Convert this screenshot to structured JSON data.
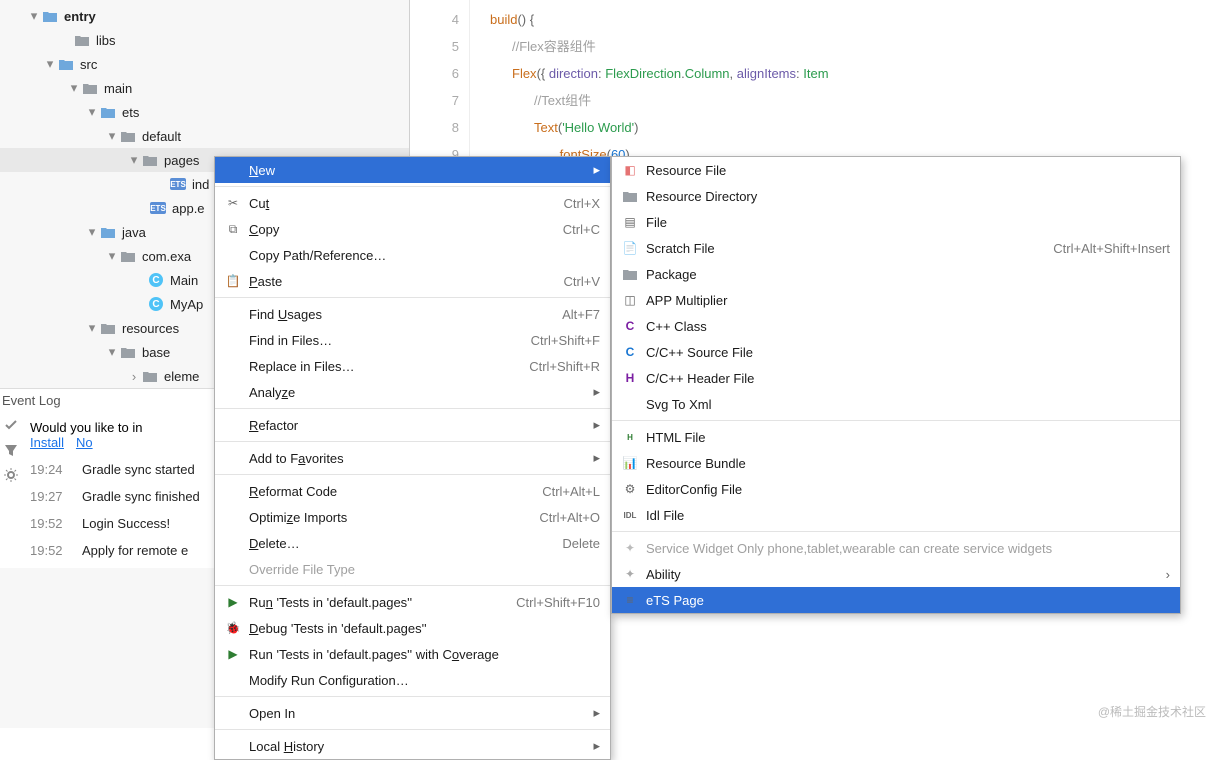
{
  "tree": {
    "entry": "entry",
    "libs": "libs",
    "src": "src",
    "main": "main",
    "ets": "ets",
    "default": "default",
    "pages": "pages",
    "index_file": "ind",
    "app_file": "app.e",
    "java": "java",
    "com_exa": "com.exa",
    "main_file": "Main",
    "myapp": "MyAp",
    "resources": "resources",
    "base": "base",
    "elem": "eleme"
  },
  "editor": {
    "lines": [
      "4",
      "5",
      "6",
      "7",
      "8",
      "9"
    ],
    "l4_fn": "build",
    "l4_rest": "() {",
    "l5_cm": "//Flex容器组件",
    "l6_fn": "Flex",
    "l6_p1": "direction",
    "l6_v1": "FlexDirection",
    "l6_v1b": "Column",
    "l6_p2": "alignItems",
    "l6_v2": "Item",
    "l7_cm": "//Text组件",
    "l8_fn": "Text",
    "l8_str": "'Hello World'",
    "l9_fn": "fontSize",
    "l9_num": "60"
  },
  "eventlog": {
    "title": "Event Log",
    "prompt": "Would you like to in",
    "install": "Install",
    "no": "No",
    "rows": [
      {
        "t": "19:24",
        "m": "Gradle sync started"
      },
      {
        "t": "19:27",
        "m": "Gradle sync finished"
      },
      {
        "t": "19:52",
        "m": "Login Success!"
      },
      {
        "t": "19:52",
        "m": "Apply for remote e"
      }
    ]
  },
  "menu": {
    "new": "New",
    "cut": "Cut",
    "cut_s": "Ctrl+X",
    "copy": "Copy",
    "copy_s": "Ctrl+C",
    "copypath": "Copy Path/Reference…",
    "paste": "Paste",
    "paste_s": "Ctrl+V",
    "findusages": "Find Usages",
    "findusages_s": "Alt+F7",
    "findfiles": "Find in Files…",
    "findfiles_s": "Ctrl+Shift+F",
    "replace": "Replace in Files…",
    "replace_s": "Ctrl+Shift+R",
    "analyze": "Analyze",
    "refactor": "Refactor",
    "favorites": "Add to Favorites",
    "reformat": "Reformat Code",
    "reformat_s": "Ctrl+Alt+L",
    "optimize": "Optimize Imports",
    "optimize_s": "Ctrl+Alt+O",
    "delete": "Delete…",
    "delete_s": "Delete",
    "override": "Override File Type",
    "runtests": "Run 'Tests in 'default.pages''",
    "runtests_s": "Ctrl+Shift+F10",
    "debugtests": "Debug 'Tests in 'default.pages''",
    "runcov": "Run 'Tests in 'default.pages'' with Coverage",
    "modifyrun": "Modify Run Configuration…",
    "openin": "Open In",
    "localhist": "Local History"
  },
  "submenu": {
    "resfile": "Resource File",
    "resdir": "Resource Directory",
    "file": "File",
    "scratch": "Scratch File",
    "scratch_s": "Ctrl+Alt+Shift+Insert",
    "package": "Package",
    "appmult": "APP Multiplier",
    "cppclass": "C++ Class",
    "ccsrc": "C/C++ Source File",
    "cchdr": "C/C++ Header File",
    "svg": "Svg To Xml",
    "html": "HTML File",
    "resbundle": "Resource Bundle",
    "editorconfig": "EditorConfig File",
    "idl": "Idl File",
    "servicewidget": "Service Widget Only phone,tablet,wearable can create service widgets",
    "ability": "Ability",
    "etspage": "eTS Page"
  },
  "watermark": "@稀土掘金技术社区"
}
